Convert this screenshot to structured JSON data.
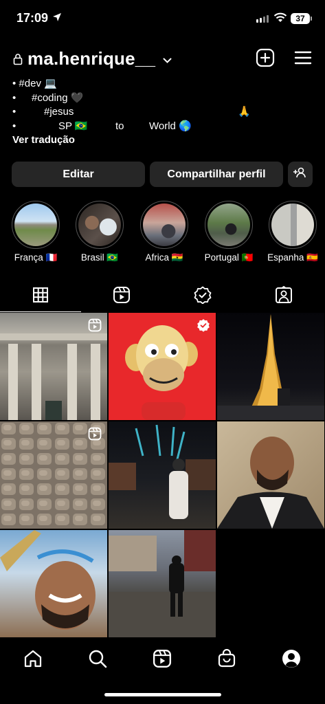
{
  "status": {
    "time": "17:09",
    "battery": "37"
  },
  "profile": {
    "username": "ma.henrique__"
  },
  "bio": {
    "line1": "• #dev 💻",
    "line2_bullet": "•",
    "line2_text": "#coding 🖤",
    "line3_bullet": "•",
    "line3_text": "#jesus",
    "line3_emoji": "🙏",
    "line4_bullet": "•",
    "line4_sp": "SP 🇧🇷",
    "line4_to": "to",
    "line4_world": "World 🌎",
    "translate": "Ver tradução"
  },
  "actions": {
    "edit": "Editar",
    "share": "Compartilhar perfil"
  },
  "highlights": [
    {
      "label": "França 🇫🇷"
    },
    {
      "label": "Brasil 🇧🇷"
    },
    {
      "label": "Africa 🇬🇭"
    },
    {
      "label": "Portugal 🇵🇹"
    },
    {
      "label": "Espanha 🇪🇸"
    }
  ],
  "tabs": [
    "grid-icon",
    "reels-icon",
    "tagged-check-icon",
    "tagged-person-icon"
  ],
  "icons": {
    "new_post": "plus-square-icon",
    "menu": "hamburger-icon",
    "add_person": "add-person-icon",
    "nav": [
      "home-icon",
      "search-icon",
      "reels-icon",
      "shop-icon",
      "profile-icon"
    ]
  },
  "colors": {
    "background": "#000000",
    "button": "#262626",
    "accent_red": "#e8282b"
  }
}
